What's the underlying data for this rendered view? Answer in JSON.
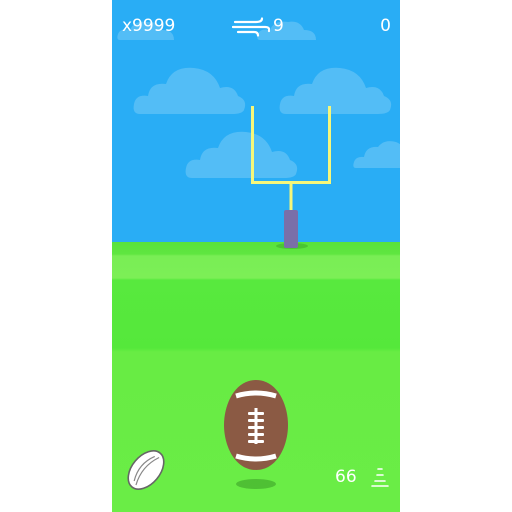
{
  "hud": {
    "balls_label": "x9999",
    "wind_icon": "wind-icon",
    "wind_value": "9",
    "score": "0",
    "distance": "66"
  },
  "icons": {
    "spare_ball": "rugby-ball-icon",
    "distance": "cone-icon"
  },
  "colors": {
    "sky": "#29adf5",
    "grass": "#55e83b",
    "goalpost": "#f5f77a",
    "post_pad": "#7a6fa8",
    "ball": "#8b5a44"
  }
}
